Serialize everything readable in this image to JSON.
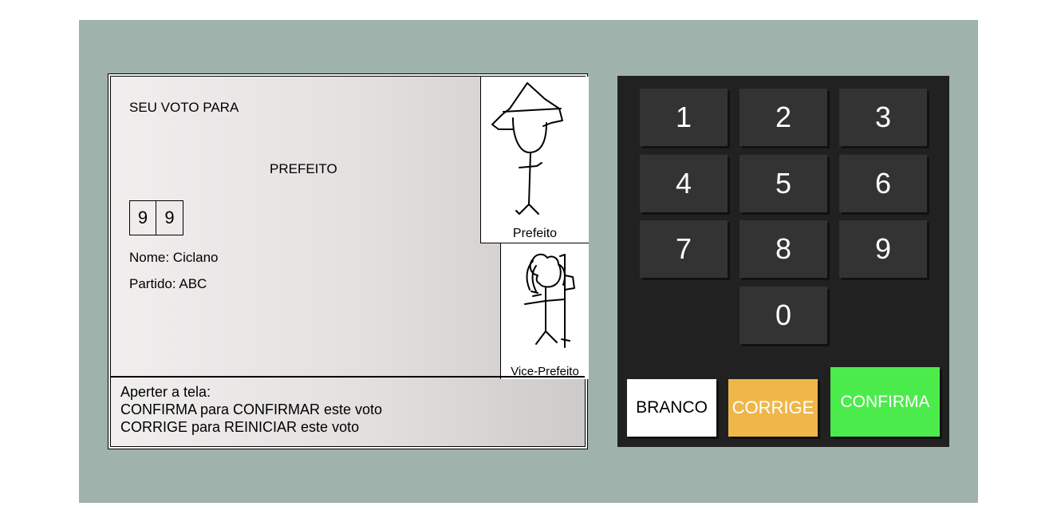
{
  "tela": {
    "titulo": "SEU VOTO PARA",
    "cargo": "PREFEITO",
    "digitos": [
      "9",
      "9"
    ],
    "nome": "Nome: Ciclano",
    "partido": "Partido: ABC",
    "foto_prefeito_legenda": "Prefeito",
    "foto_vice_legenda": "Vice-Prefeito",
    "instrucoes": [
      "Aperter a tela:",
      "CONFIRMA para CONFIRMAR este voto",
      "CORRIGE para REINICIAR este voto"
    ]
  },
  "teclado": {
    "teclas": [
      "1",
      "2",
      "3",
      "4",
      "5",
      "6",
      "7",
      "8",
      "9",
      "0"
    ],
    "branco": "BRANCO",
    "corrige": "CORRIGE",
    "confirma": "CONFIRMA"
  },
  "colors": {
    "fundo_urna": "#9fb2ac",
    "teclado": "#212121",
    "tecla": "#333333",
    "corrige": "#efb74a",
    "confirma": "#4ceb4c"
  }
}
